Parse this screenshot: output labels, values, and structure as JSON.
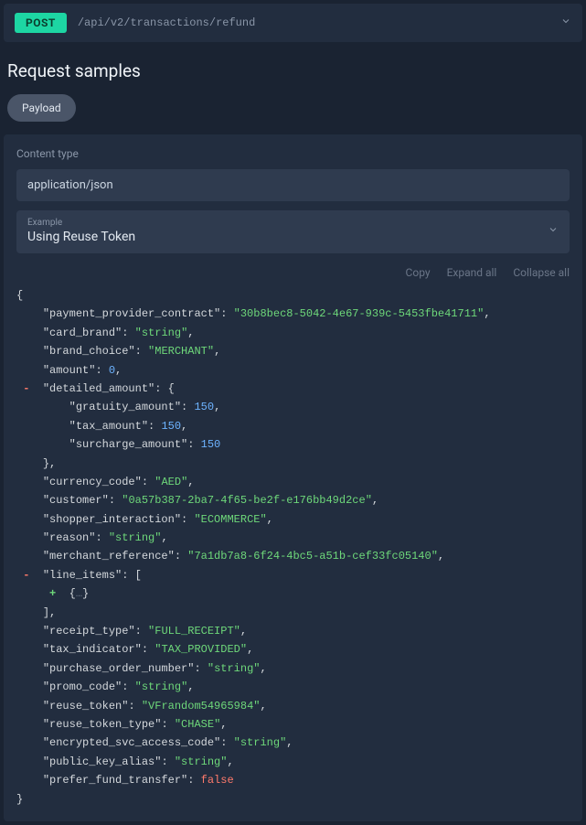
{
  "endpoint": {
    "method": "POST",
    "path": "/api/v2/transactions/refund"
  },
  "section_title": "Request samples",
  "tabs": {
    "payload": "Payload"
  },
  "content_type": {
    "label": "Content type",
    "value": "application/json"
  },
  "example": {
    "label": "Example",
    "value": "Using Reuse Token"
  },
  "toolbar": {
    "copy": "Copy",
    "expand": "Expand all",
    "collapse": "Collapse all"
  },
  "json": {
    "payment_provider_contract": "30b8bec8-5042-4e67-939c-5453fbe41711",
    "card_brand": "string",
    "brand_choice": "MERCHANT",
    "amount": "0",
    "detailed_amount": {
      "gratuity_amount": "150",
      "tax_amount": "150",
      "surcharge_amount": "150"
    },
    "currency_code": "AED",
    "customer": "0a57b387-2ba7-4f65-be2f-e176bb49d2ce",
    "shopper_interaction": "ECOMMERCE",
    "reason": "string",
    "merchant_reference": "7a1db7a8-6f24-4bc5-a51b-cef33fc05140",
    "line_items_label": "line_items",
    "receipt_type": "FULL_RECEIPT",
    "tax_indicator": "TAX_PROVIDED",
    "purchase_order_number": "string",
    "promo_code": "string",
    "reuse_token": "VFrandom54965984",
    "reuse_token_type": "CHASE",
    "encrypted_svc_access_code": "string",
    "public_key_alias": "string",
    "prefer_fund_transfer": "false"
  },
  "keys": {
    "payment_provider_contract": "payment_provider_contract",
    "card_brand": "card_brand",
    "brand_choice": "brand_choice",
    "amount": "amount",
    "detailed_amount": "detailed_amount",
    "gratuity_amount": "gratuity_amount",
    "tax_amount": "tax_amount",
    "surcharge_amount": "surcharge_amount",
    "currency_code": "currency_code",
    "customer": "customer",
    "shopper_interaction": "shopper_interaction",
    "reason": "reason",
    "merchant_reference": "merchant_reference",
    "line_items": "line_items",
    "receipt_type": "receipt_type",
    "tax_indicator": "tax_indicator",
    "purchase_order_number": "purchase_order_number",
    "promo_code": "promo_code",
    "reuse_token": "reuse_token",
    "reuse_token_type": "reuse_token_type",
    "encrypted_svc_access_code": "encrypted_svc_access_code",
    "public_key_alias": "public_key_alias",
    "prefer_fund_transfer": "prefer_fund_transfer"
  }
}
